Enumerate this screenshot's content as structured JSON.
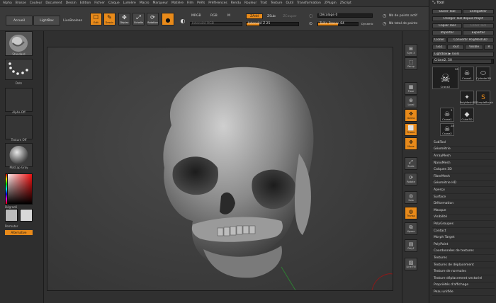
{
  "menu": [
    "Alpha",
    "Brosse",
    "Couleur",
    "Document",
    "Dessin",
    "Edition",
    "Fichier",
    "Calque",
    "Lumière",
    "Macro",
    "Marqueur",
    "Matière",
    "Film",
    "Préfs",
    "Préférences",
    "Rendu",
    "Rouleur",
    "Trait",
    "Texture",
    "Outil",
    "Transformation",
    "ZPlugin",
    "ZScript"
  ],
  "top": {
    "home_tab": "Accueil",
    "lightbox_tab": "LightBox",
    "lightbox_label": "LiveBoolean",
    "edit": "Edit",
    "draw": "Dessin",
    "move": "Déplac",
    "scale": "Echelle",
    "rotate": "Rotation",
    "mrgb": "MRGB",
    "rgb": "RGB",
    "m": "M",
    "zadd": "ZAdd",
    "zsub": "ZSub",
    "zcut": "ZCouper",
    "rgb_intensity": "Intensité RGB",
    "z_intensity": "Intensité Z 25",
    "focal_shift": "Décalage 0",
    "draw_size": "Taille Brosse 64",
    "dynamic": "Dynamic",
    "active_points": "Nb de points actif",
    "total_points": "Nb total de points",
    "z_intensity_level": 0.25,
    "draw_size_level": 0.5
  },
  "left": {
    "brush": "Standard",
    "stroke": "Dots",
    "alpha": "Alpha Off",
    "texture": "Texture Off",
    "material": "MatCap Gray",
    "gradient": "Dégradé",
    "switch_color": "Permuter",
    "alternate": "Alternative"
  },
  "right_shelf": [
    "Sym 3",
    "Persp",
    "Floor",
    "Local",
    "Gizmo",
    "Frame",
    "Move",
    "Scale",
    "Rotate",
    "Solo",
    "Transp",
    "Xpose",
    "PolyF",
    "Line Fill"
  ],
  "tray": {
    "title": "Tool",
    "load": "Ouvrir Tool",
    "save_as": "Enregistrer",
    "load_project": "Charger Tool depuis Projet",
    "copy_tool": "Copier Tool",
    "paste_tool": "Coller Tool",
    "import": "Importer",
    "export": "Exporter",
    "clone": "Cloner",
    "make_polymesh": "Convertir PolyMesh3D",
    "goz": "GoZ",
    "all": "Tout",
    "visible": "Visible",
    "r": "R",
    "lightbox_tools": "Lightbox ▶ Tools",
    "current_tool": "Crâne2. 50",
    "tools": [
      {
        "name": "Crane2",
        "count": "28"
      },
      {
        "name": "Crane1",
        "count": ""
      },
      {
        "name": "Cylinder3D",
        "count": ""
      },
      {
        "name": "PolyMesh3D",
        "count": ""
      },
      {
        "name": "SimpleBrush",
        "count": ""
      },
      {
        "name": "Crane1",
        "count": "3"
      },
      {
        "name": "Cube3D",
        "count": ""
      },
      {
        "name": "Crane2",
        "count": "28"
      }
    ],
    "subpalettes": [
      "SubTool",
      "Géométrie",
      "ArrayMesh",
      "NanoMesh",
      "Calques 3D",
      "FiberMesh",
      "Géométrie HD",
      "Aperçu",
      "Surface",
      "Déformation",
      "Masque",
      "Visibilité",
      "PolyGroupes",
      "Contact",
      "Morph Target",
      "PolyPaint",
      "Coordonnées de textures",
      "Textures",
      "Textures de déplacement",
      "Texture de normales",
      "Texture déplacement vectoriel",
      "Propriétés d'affichage",
      "Peau unifiée"
    ]
  }
}
